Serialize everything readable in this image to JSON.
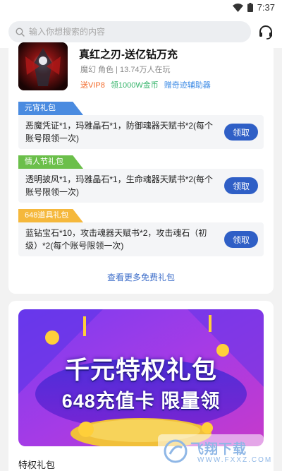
{
  "status": {
    "time": "7:37"
  },
  "search": {
    "placeholder": "输入你想搜索的内容"
  },
  "game": {
    "title": "真红之刃-送亿钻万充",
    "meta": "魔幻 角色 | 13.74万人在玩",
    "tags": [
      "送VIP8",
      "领1000W金币",
      "赠奇迹辅助器"
    ]
  },
  "gifts": [
    {
      "label": "元宵礼包",
      "text": "恶魔凭证*1，玛雅晶石*1，防御魂器天赋书*2(每个账号限领一次)",
      "button": "领取",
      "color": "#4a8be0"
    },
    {
      "label": "情人节礼包",
      "text": "透明披风*1，玛雅晶石*1，生命魂器天赋书*2(每个账号限领一次)",
      "button": "领取",
      "color": "#6bbf4a"
    },
    {
      "label": "648道具礼包",
      "text": "蓝钻宝石*10，攻击魂器天赋书*2，攻击魂石（初级）*2(每个账号限领一次)",
      "button": "领取",
      "color": "#f5b83c"
    }
  ],
  "more_link": "查看更多免费礼包",
  "banner": {
    "title": "千元特权礼包",
    "subtitle": "648充值卡  限量领"
  },
  "section_title": "特权礼包",
  "watermark": {
    "main": "飞翔下载",
    "sub": "WWW.FXXZ.COM"
  }
}
